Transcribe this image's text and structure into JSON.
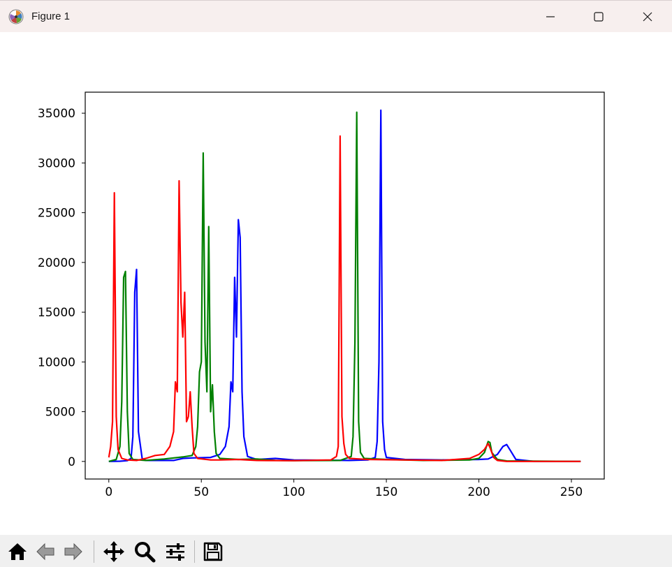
{
  "window": {
    "title": "Figure 1",
    "icons": [
      "matplotlib-icon",
      "minimize-icon",
      "maximize-icon",
      "close-icon"
    ]
  },
  "toolbar": {
    "buttons": [
      {
        "name": "home-button",
        "icon": "home-icon"
      },
      {
        "name": "back-button",
        "icon": "back-arrow-icon"
      },
      {
        "name": "forward-button",
        "icon": "forward-arrow-icon"
      },
      {
        "name": "pan-button",
        "icon": "move-icon"
      },
      {
        "name": "zoom-button",
        "icon": "zoom-icon"
      },
      {
        "name": "configure-subplots-button",
        "icon": "sliders-icon"
      },
      {
        "name": "save-button",
        "icon": "save-icon"
      }
    ]
  },
  "chart_data": {
    "type": "line",
    "title": "",
    "xlabel": "",
    "ylabel": "",
    "xlim": [
      -12.75,
      267.75
    ],
    "ylim": [
      -1767,
      37113
    ],
    "xticks": [
      0,
      50,
      100,
      150,
      200,
      250
    ],
    "yticks": [
      0,
      5000,
      10000,
      15000,
      20000,
      25000,
      30000,
      35000
    ],
    "grid": false,
    "legend": "none",
    "series": [
      {
        "color": "#0000ff",
        "points": [
          [
            0,
            0
          ],
          [
            6,
            20
          ],
          [
            10,
            80
          ],
          [
            12,
            300
          ],
          [
            13,
            2500
          ],
          [
            14,
            17000
          ],
          [
            15,
            19300
          ],
          [
            16,
            3000
          ],
          [
            18,
            300
          ],
          [
            20,
            100
          ],
          [
            35,
            100
          ],
          [
            40,
            300
          ],
          [
            45,
            350
          ],
          [
            55,
            400
          ],
          [
            60,
            700
          ],
          [
            63,
            1500
          ],
          [
            65,
            3500
          ],
          [
            66,
            8000
          ],
          [
            67,
            7000
          ],
          [
            68,
            18500
          ],
          [
            69,
            12500
          ],
          [
            70,
            24300
          ],
          [
            71,
            22500
          ],
          [
            72,
            7000
          ],
          [
            73,
            2500
          ],
          [
            75,
            500
          ],
          [
            80,
            200
          ],
          [
            90,
            300
          ],
          [
            100,
            150
          ],
          [
            130,
            100
          ],
          [
            140,
            150
          ],
          [
            144,
            400
          ],
          [
            145,
            2000
          ],
          [
            146,
            10000
          ],
          [
            147,
            35300
          ],
          [
            148,
            4000
          ],
          [
            149,
            1200
          ],
          [
            150,
            400
          ],
          [
            160,
            200
          ],
          [
            180,
            150
          ],
          [
            200,
            200
          ],
          [
            205,
            250
          ],
          [
            210,
            700
          ],
          [
            213,
            1500
          ],
          [
            215,
            1700
          ],
          [
            217,
            1100
          ],
          [
            220,
            200
          ],
          [
            230,
            0
          ],
          [
            255,
            0
          ]
        ]
      },
      {
        "color": "#008000",
        "points": [
          [
            0,
            0
          ],
          [
            4,
            200
          ],
          [
            6,
            1500
          ],
          [
            7,
            6000
          ],
          [
            8,
            18500
          ],
          [
            9,
            19100
          ],
          [
            10,
            5000
          ],
          [
            11,
            800
          ],
          [
            13,
            200
          ],
          [
            20,
            100
          ],
          [
            30,
            250
          ],
          [
            40,
            450
          ],
          [
            45,
            600
          ],
          [
            47,
            1500
          ],
          [
            48,
            3500
          ],
          [
            49,
            9000
          ],
          [
            50,
            10000
          ],
          [
            51,
            31000
          ],
          [
            52,
            12000
          ],
          [
            53,
            7000
          ],
          [
            54,
            23600
          ],
          [
            55,
            5000
          ],
          [
            56,
            7700
          ],
          [
            57,
            3000
          ],
          [
            58,
            800
          ],
          [
            60,
            300
          ],
          [
            70,
            200
          ],
          [
            80,
            250
          ],
          [
            90,
            100
          ],
          [
            100,
            80
          ],
          [
            125,
            100
          ],
          [
            131,
            500
          ],
          [
            132,
            2500
          ],
          [
            133,
            12000
          ],
          [
            134,
            35100
          ],
          [
            135,
            4000
          ],
          [
            136,
            900
          ],
          [
            138,
            300
          ],
          [
            150,
            200
          ],
          [
            170,
            100
          ],
          [
            195,
            150
          ],
          [
            200,
            300
          ],
          [
            203,
            900
          ],
          [
            205,
            2000
          ],
          [
            206,
            1900
          ],
          [
            207,
            900
          ],
          [
            210,
            200
          ],
          [
            215,
            50
          ],
          [
            255,
            0
          ]
        ]
      },
      {
        "color": "#ff0000",
        "points": [
          [
            0,
            400
          ],
          [
            1,
            1500
          ],
          [
            2,
            4000
          ],
          [
            3,
            27000
          ],
          [
            4,
            4500
          ],
          [
            5,
            1200
          ],
          [
            7,
            300
          ],
          [
            10,
            150
          ],
          [
            15,
            100
          ],
          [
            20,
            300
          ],
          [
            25,
            600
          ],
          [
            30,
            700
          ],
          [
            33,
            1500
          ],
          [
            35,
            3000
          ],
          [
            36,
            8000
          ],
          [
            37,
            7000
          ],
          [
            38,
            28200
          ],
          [
            39,
            16000
          ],
          [
            40,
            12500
          ],
          [
            41,
            17000
          ],
          [
            42,
            4000
          ],
          [
            43,
            4500
          ],
          [
            44,
            7000
          ],
          [
            45,
            3500
          ],
          [
            46,
            800
          ],
          [
            48,
            300
          ],
          [
            55,
            150
          ],
          [
            60,
            150
          ],
          [
            70,
            200
          ],
          [
            80,
            100
          ],
          [
            100,
            80
          ],
          [
            120,
            150
          ],
          [
            123,
            500
          ],
          [
            124,
            1500
          ],
          [
            125,
            32700
          ],
          [
            126,
            4500
          ],
          [
            127,
            1800
          ],
          [
            128,
            700
          ],
          [
            130,
            300
          ],
          [
            140,
            200
          ],
          [
            160,
            150
          ],
          [
            180,
            100
          ],
          [
            195,
            300
          ],
          [
            200,
            700
          ],
          [
            203,
            1200
          ],
          [
            205,
            1800
          ],
          [
            206,
            1400
          ],
          [
            208,
            400
          ],
          [
            210,
            100
          ],
          [
            215,
            0
          ],
          [
            255,
            0
          ]
        ]
      }
    ]
  }
}
